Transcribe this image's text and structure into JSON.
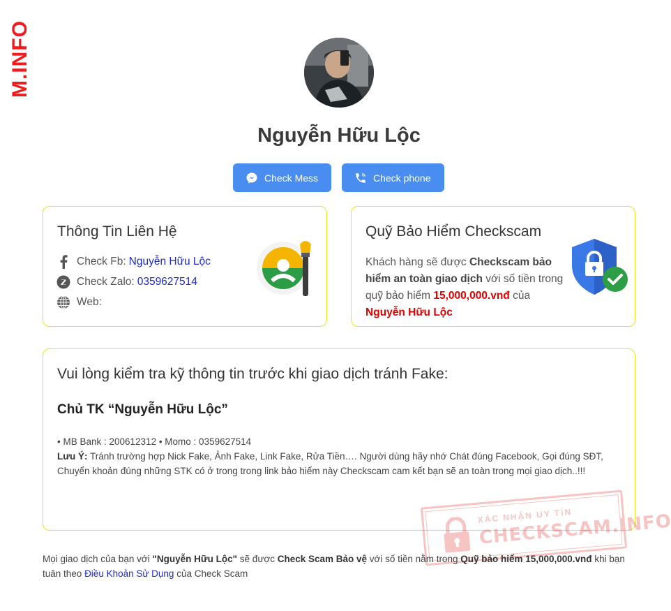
{
  "watermark": {
    "side_text": "M.INFO"
  },
  "profile": {
    "name": "Nguyễn Hữu Lộc"
  },
  "buttons": {
    "mess_label": "Check Mess",
    "phone_label": "Check phone"
  },
  "contact": {
    "title": "Thông Tin Liên Hệ",
    "fb_label": "Check Fb:",
    "fb_value": "Nguyễn Hữu Lộc",
    "zalo_label": "Check Zalo:",
    "zalo_value": "0359627514",
    "web_label": "Web:"
  },
  "insurance": {
    "title": "Quỹ Bảo Hiểm Checkscam",
    "t1": "Khách hàng sẽ được ",
    "b1": "Checkscam bảo hiểm an toàn giao dịch",
    "t2": " với số tiền trong quỹ bảo hiểm ",
    "amount": "15,000,000.vnđ",
    "t3": " của",
    "owner": "Nguyễn Hữu Lộc"
  },
  "verify": {
    "title": "Vui lòng kiểm tra kỹ thông tin trước khi giao dịch tránh Fake:",
    "subtitle": "Chủ TK “Nguyễn Hữu Lộc”",
    "accounts": "• MB Bank : 200612312 • Momo : 0359627514",
    "note_label": "Lưu Ý:",
    "note_text": " Tránh trường hợp Nick Fake, Ảnh Fake, Link Fake, Rửa Tiền…. Người dùng hãy nhớ Chát đúng Facebook, Gọi đúng SĐT, Chuyển khoản đúng những STK có ở trong trong link bảo hiểm này Checkscam cam kết bạn sẽ an toàn trong mọi giao dịch..!!!"
  },
  "stamp": {
    "small": "XÁC NHẬN UY TÍN",
    "big": "CHECKSCAM.INFO"
  },
  "footer": {
    "t1": "Mọi giao dịch của bạn với ",
    "b1": "\"Nguyễn Hữu Lộc\"",
    "t2": " sẽ được ",
    "b2": "Check Scam Bảo vệ",
    "t3": " với số tiền nằm trong ",
    "b3": "Quỹ bảo hiểm 15,000,000.vnđ",
    "t4": " khi bạn tuân theo ",
    "link": "Điều Khoản Sử Dụng",
    "t5": " của Check Scam"
  },
  "colors": {
    "accent": "#4a8df0",
    "card_border": "#e6e61f",
    "highlight_red": "#e10000",
    "link": "#1d2bc8"
  },
  "icons": [
    "messenger-icon",
    "phone-icon",
    "facebook-icon",
    "zalo-icon",
    "globe-icon",
    "lock-icon",
    "check-icon"
  ]
}
